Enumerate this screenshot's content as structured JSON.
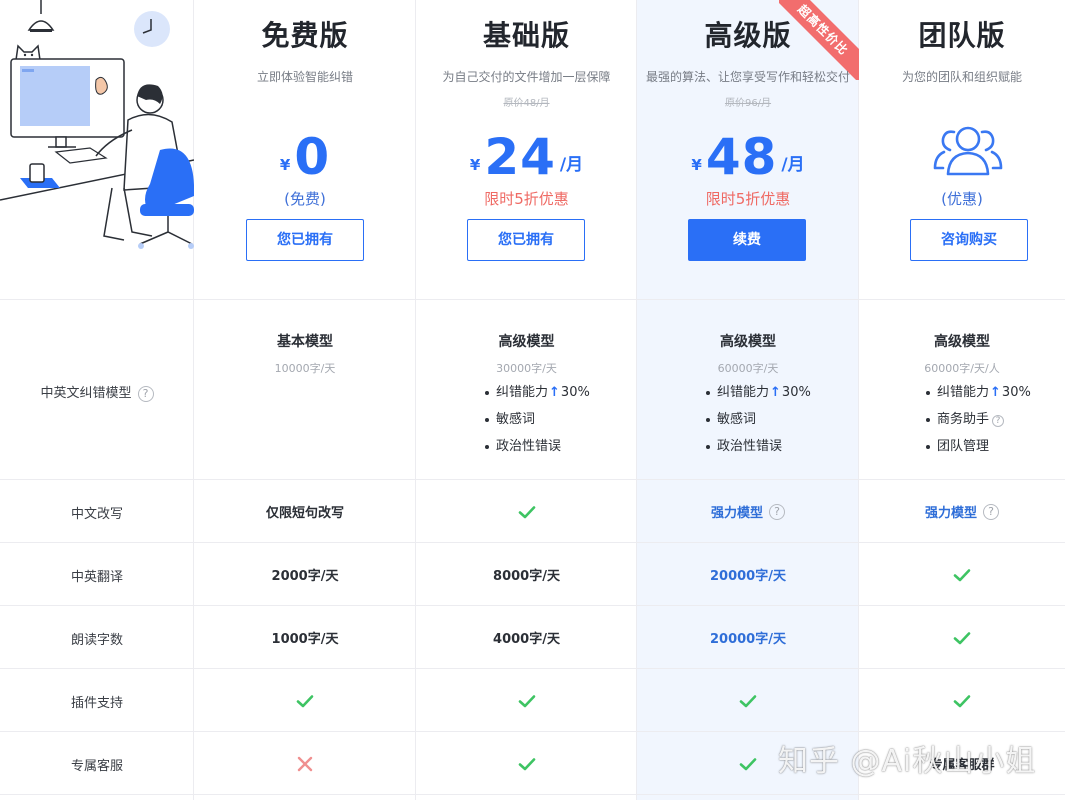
{
  "plans": [
    {
      "name": "免费版",
      "desc": "立即体验智能纠错",
      "currency": "¥",
      "amount": "0",
      "unit": "",
      "note": "(免费)",
      "button": "您已拥有"
    },
    {
      "name": "基础版",
      "desc": "为自己交付的文件增加一层保障",
      "orig": "原价48/月",
      "currency": "¥",
      "amount": "24",
      "unit": "/月",
      "note": "限时5折优惠",
      "button": "您已拥有"
    },
    {
      "name": "高级版",
      "desc": "最强的算法、让您享受写作和轻松交付",
      "orig": "原价96/月",
      "currency": "¥",
      "amount": "48",
      "unit": "/月",
      "note": "限时5折优惠",
      "button": "续费",
      "ribbon": "超高性价比"
    },
    {
      "name": "团队版",
      "desc": "为您的团队和组织赋能",
      "note": "(优惠)",
      "button": "咨询购买"
    }
  ],
  "rows": {
    "model": {
      "label": "中英文纠错模型",
      "cells": [
        {
          "title": "基本模型",
          "quota": "10000字/天"
        },
        {
          "title": "高级模型",
          "quota": "30000字/天",
          "features": [
            "纠错能力",
            "敏感词",
            "政治性错误"
          ],
          "boost": "30%"
        },
        {
          "title": "高级模型",
          "quota": "60000字/天",
          "features": [
            "纠错能力",
            "敏感词",
            "政治性错误"
          ],
          "boost": "30%"
        },
        {
          "title": "高级模型",
          "quota": "60000字/天/人",
          "features": [
            "纠错能力",
            "商务助手",
            "团队管理"
          ],
          "boost": "30%"
        }
      ]
    },
    "rewrite": {
      "label": "中文改写",
      "cells": [
        "仅限短句改写",
        "check",
        "强力模型",
        "强力模型"
      ]
    },
    "translate": {
      "label": "中英翻译",
      "cells": [
        "2000字/天",
        "8000字/天",
        "20000字/天",
        "check"
      ]
    },
    "read": {
      "label": "朗读字数",
      "cells": [
        "1000字/天",
        "4000字/天",
        "20000字/天",
        "check"
      ]
    },
    "plugin": {
      "label": "插件支持",
      "cells": [
        "check",
        "check",
        "check",
        "check"
      ]
    },
    "service": {
      "label": "专属客服",
      "cells": [
        "cross",
        "check",
        "check",
        "专属客服群"
      ]
    }
  },
  "watermark": "知乎 @Ai秋山小姐",
  "colors": {
    "accent": "#2a6ff6",
    "promo": "#ef6a64",
    "check": "#3ec463",
    "cross": "#f08f8f",
    "highlight_col": "#f1f6fe"
  }
}
